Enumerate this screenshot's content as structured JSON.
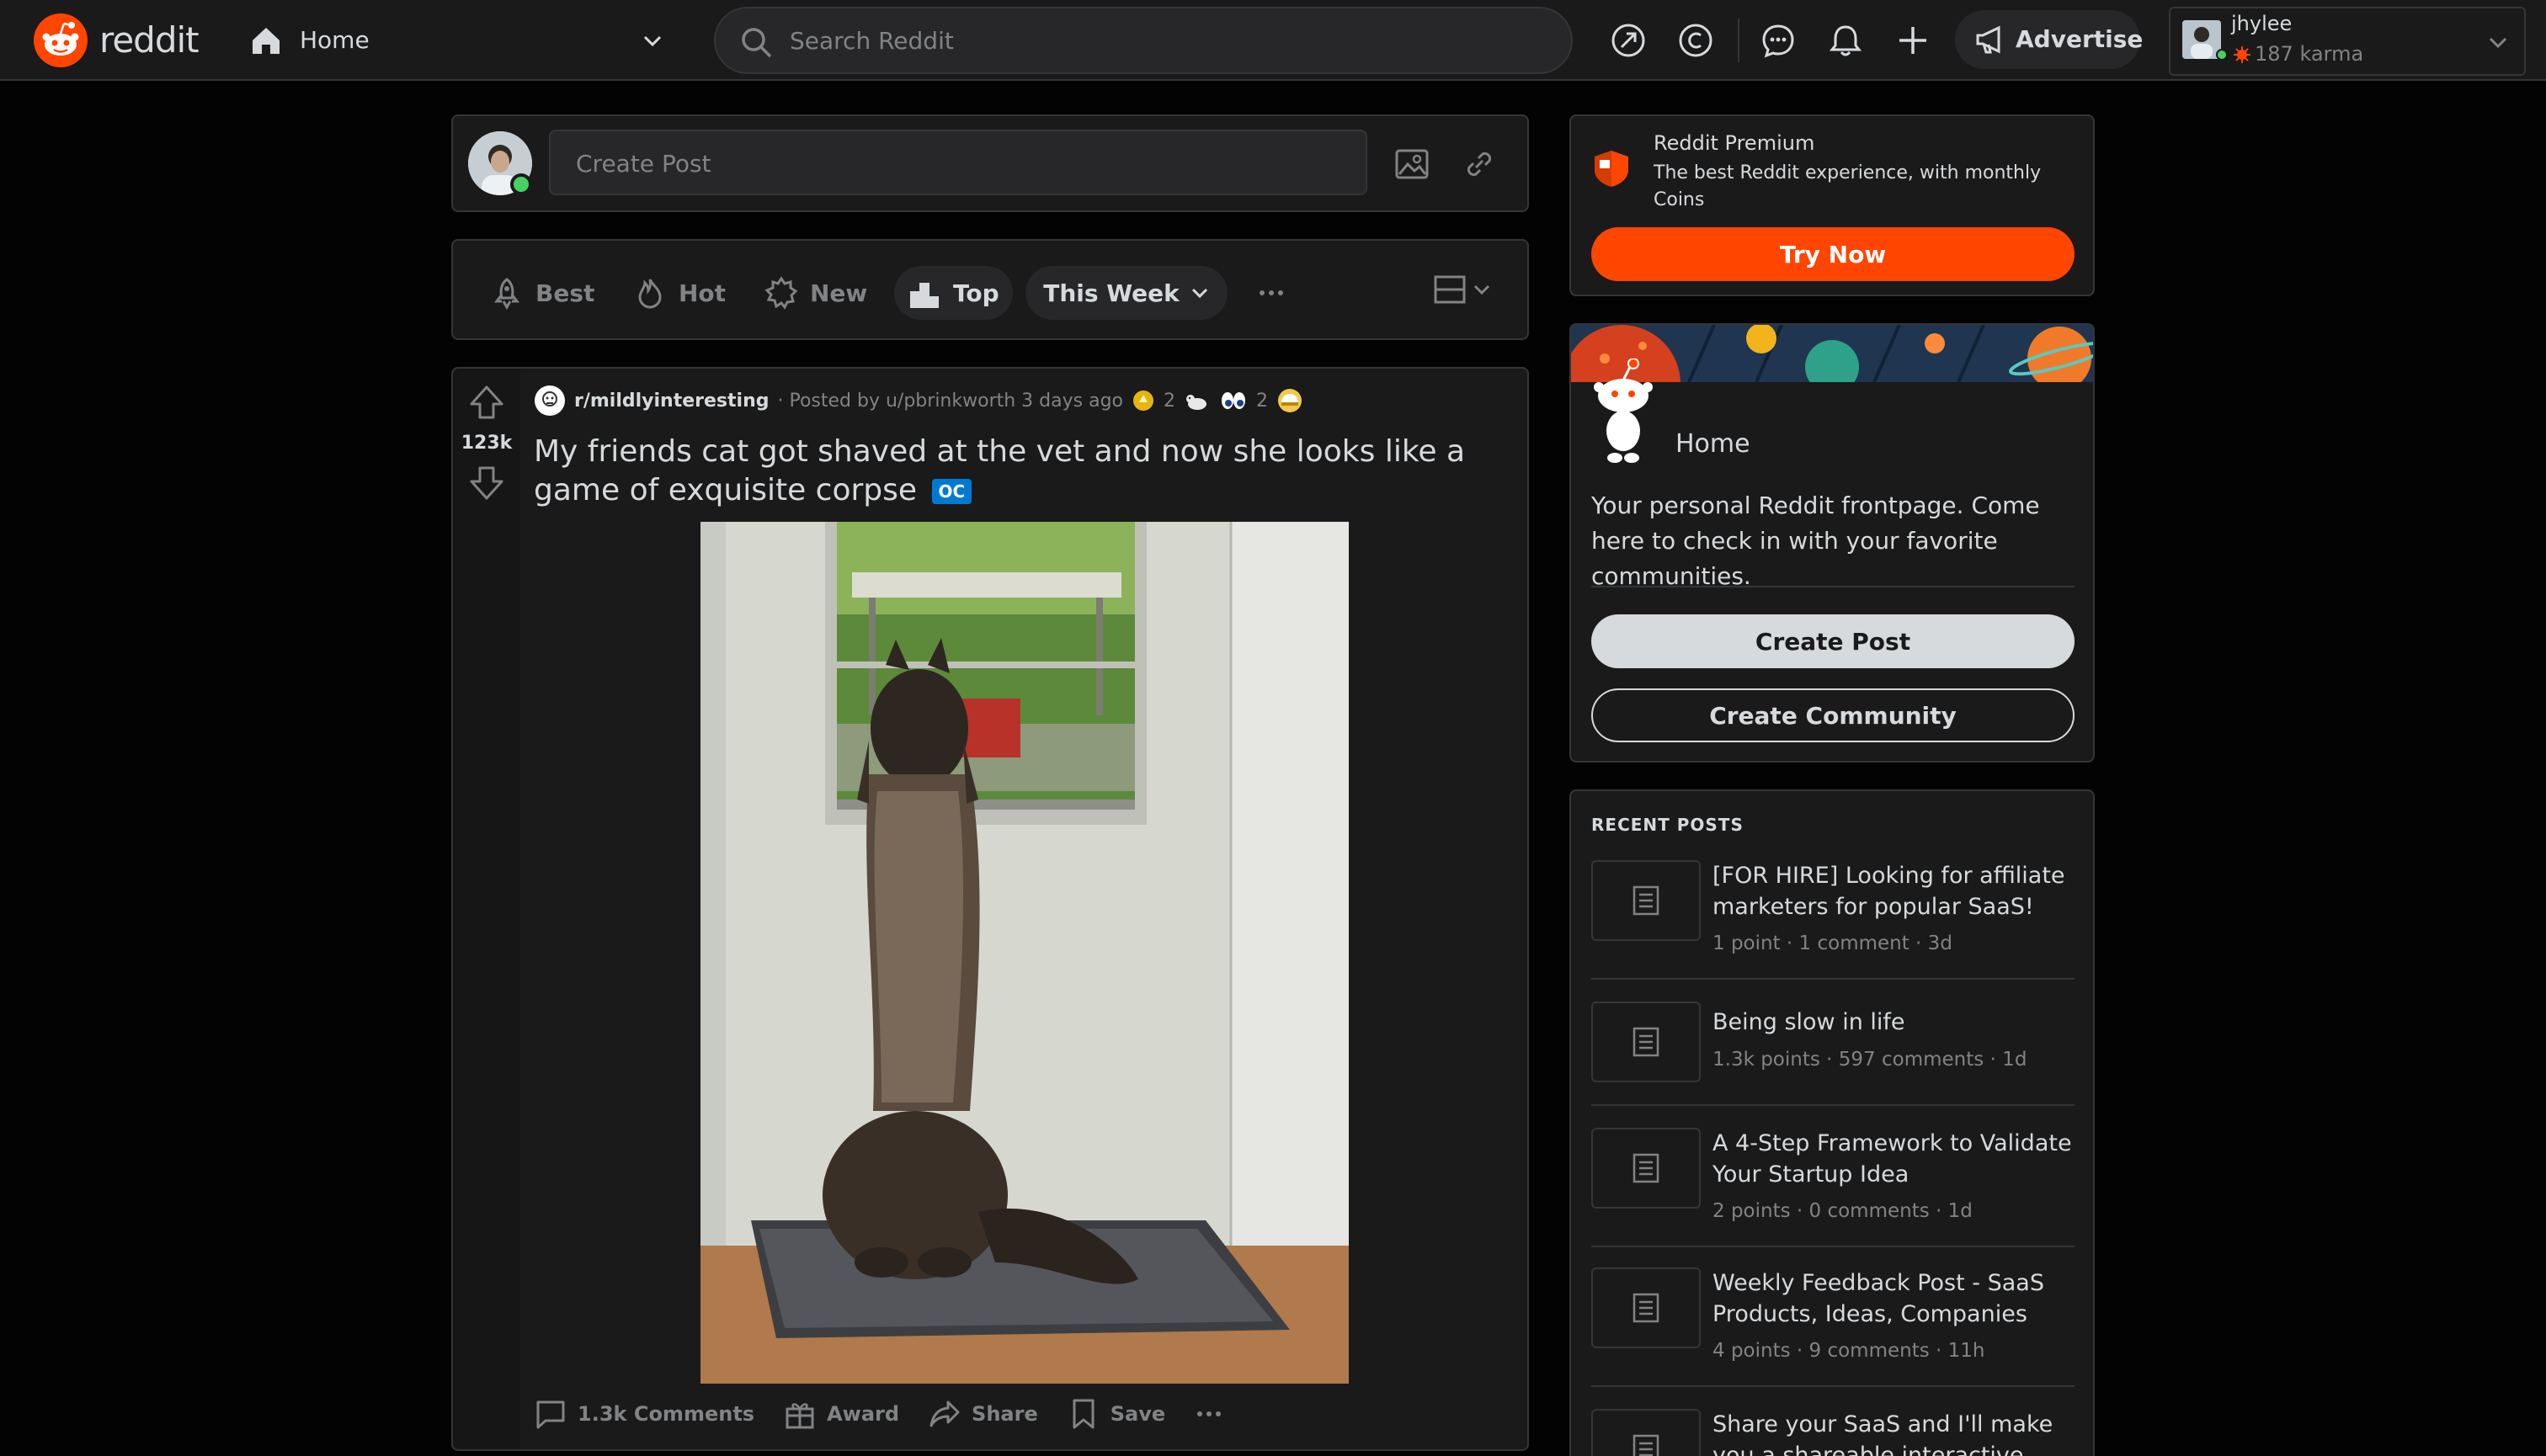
{
  "header": {
    "logo_text": "reddit",
    "home_label": "Home",
    "search_placeholder": "Search Reddit",
    "advertise_label": "Advertise",
    "username": "jhylee",
    "karma": "187 karma"
  },
  "create_post": {
    "placeholder": "Create Post"
  },
  "sort": {
    "best": "Best",
    "hot": "Hot",
    "new": "New",
    "top": "Top",
    "time_filter": "This Week"
  },
  "post": {
    "votes": "123k",
    "subreddit": "r/mildlyinteresting",
    "posted_by": "· Posted by u/pbrinkworth 3 days ago",
    "award_count_1": "2",
    "award_count_2": "2",
    "title": "My friends cat got shaved at the vet and now she looks like a game of exquisite corpse",
    "flair": "OC",
    "comments": "1.3k Comments",
    "award": "Award",
    "share": "Share",
    "save": "Save"
  },
  "premium": {
    "title": "Reddit Premium",
    "description": "The best Reddit experience, with monthly Coins",
    "button": "Try Now"
  },
  "home_card": {
    "title": "Home",
    "description": "Your personal Reddit frontpage. Come here to check in with your favorite communities.",
    "create_post": "Create Post",
    "create_community": "Create Community"
  },
  "recent_posts": {
    "heading": "RECENT POSTS",
    "items": [
      {
        "title": "[FOR HIRE] Looking for affiliate marketers for popular SaaS!",
        "meta": "1 point · 1 comment · 3d"
      },
      {
        "title": "Being slow in life",
        "meta": "1.3k points · 597 comments · 1d"
      },
      {
        "title": "A 4-Step Framework to Validate Your Startup Idea",
        "meta": "2 points · 0 comments · 1d"
      },
      {
        "title": "Weekly Feedback Post - SaaS Products, Ideas, Companies",
        "meta": "4 points · 9 comments · 11h"
      },
      {
        "title": "Share your SaaS and I'll make you a shareable interactive demo",
        "meta": ""
      }
    ]
  },
  "colors": {
    "accent": "#ff4500",
    "background": "#030303",
    "card": "#1a1a1b",
    "border": "#343536",
    "oc_flair": "#0079d3"
  }
}
